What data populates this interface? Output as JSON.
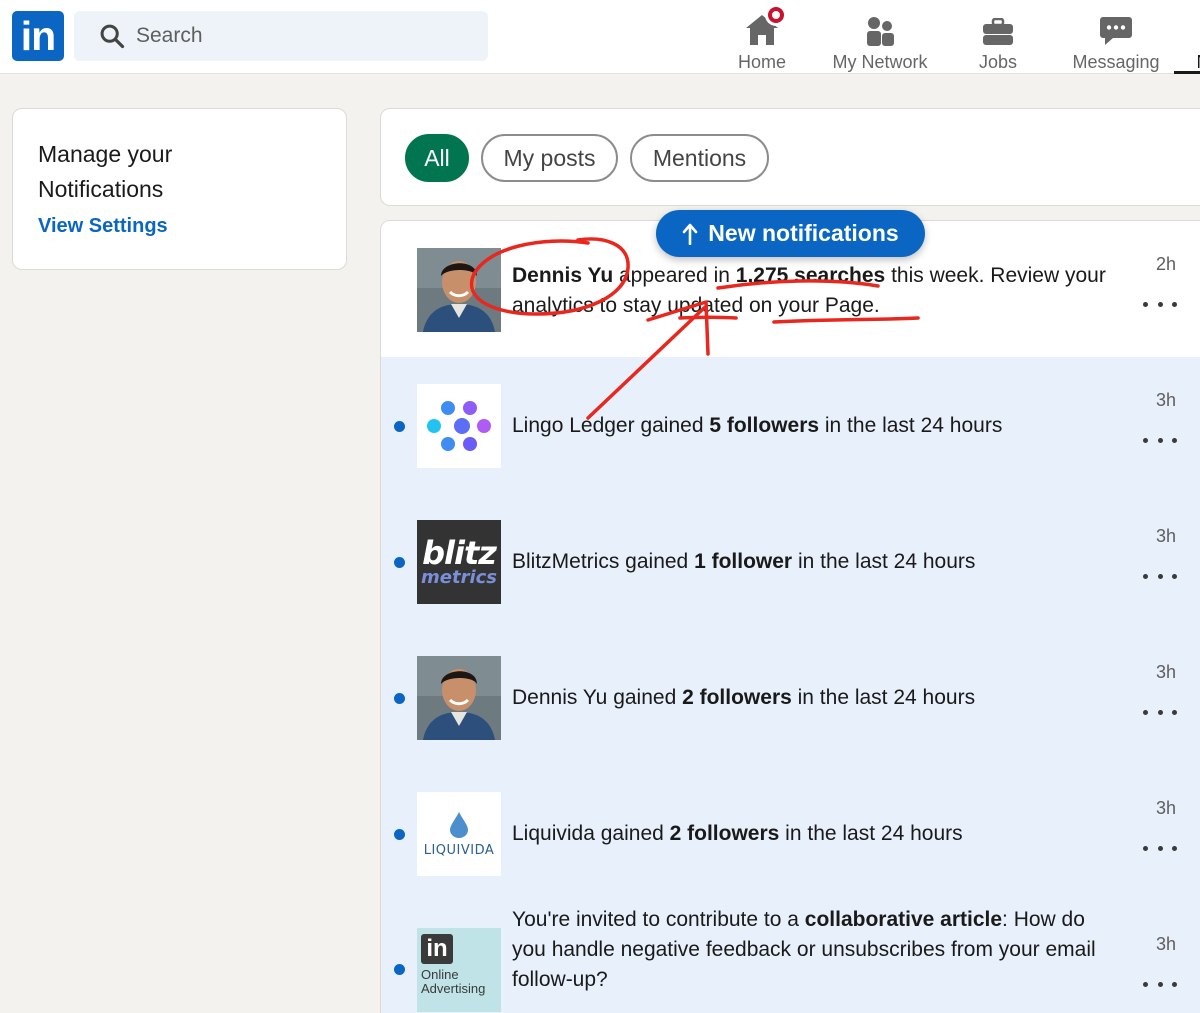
{
  "nav": {
    "logo_text": "in",
    "search_placeholder": "Search",
    "items": [
      {
        "label": "Home",
        "icon": "home-icon"
      },
      {
        "label": "My Network",
        "icon": "network-icon"
      },
      {
        "label": "Jobs",
        "icon": "briefcase-icon"
      },
      {
        "label": "Messaging",
        "icon": "messaging-icon"
      },
      {
        "label": "No",
        "icon": "bell-icon"
      }
    ]
  },
  "sidebar": {
    "title_line1": "Manage your",
    "title_line2": "Notifications",
    "link": "View Settings"
  },
  "filters": {
    "all": "All",
    "my_posts": "My posts",
    "mentions": "Mentions"
  },
  "new_notifications_label": "New notifications",
  "notifications": [
    {
      "actor": "Dennis Yu",
      "text_a": " appeared in ",
      "bold_b": "1,275 searches",
      "text_c": " this week. Review your analytics to stay updated on your Page.",
      "time": "2h"
    },
    {
      "actor_plain": "Lingo Ledger",
      "text_a": " gained ",
      "bold_b": "5 followers",
      "text_c": " in the last 24 hours",
      "time": "3h"
    },
    {
      "actor_plain": "BlitzMetrics",
      "text_a": " gained ",
      "bold_b": "1 follower",
      "text_c": " in the last 24 hours",
      "time": "3h",
      "logo_top": "blitz",
      "logo_bottom": "metrics"
    },
    {
      "actor_plain": "Dennis Yu",
      "text_a": " gained ",
      "bold_b": "2 followers",
      "text_c": " in the last 24 hours",
      "time": "3h"
    },
    {
      "actor_plain": "Liquivida",
      "text_a": " gained ",
      "bold_b": "2 followers",
      "text_c": " in the last 24 hours",
      "time": "3h",
      "logo_text": "LIQUIVIDA"
    },
    {
      "text_a": "You're invited to contribute to a ",
      "bold_b": "collaborative article",
      "text_c": ": How do you handle negative feedback or unsubscribes from your email follow-up?",
      "time": "3h",
      "logo_line1": "Online",
      "logo_line2": "Advertising"
    }
  ],
  "colors": {
    "linkedin_blue": "#0a66c2",
    "green_pill": "#01754f",
    "unread_bg": "#e8f0fb",
    "annotation_red": "#e8271e"
  }
}
